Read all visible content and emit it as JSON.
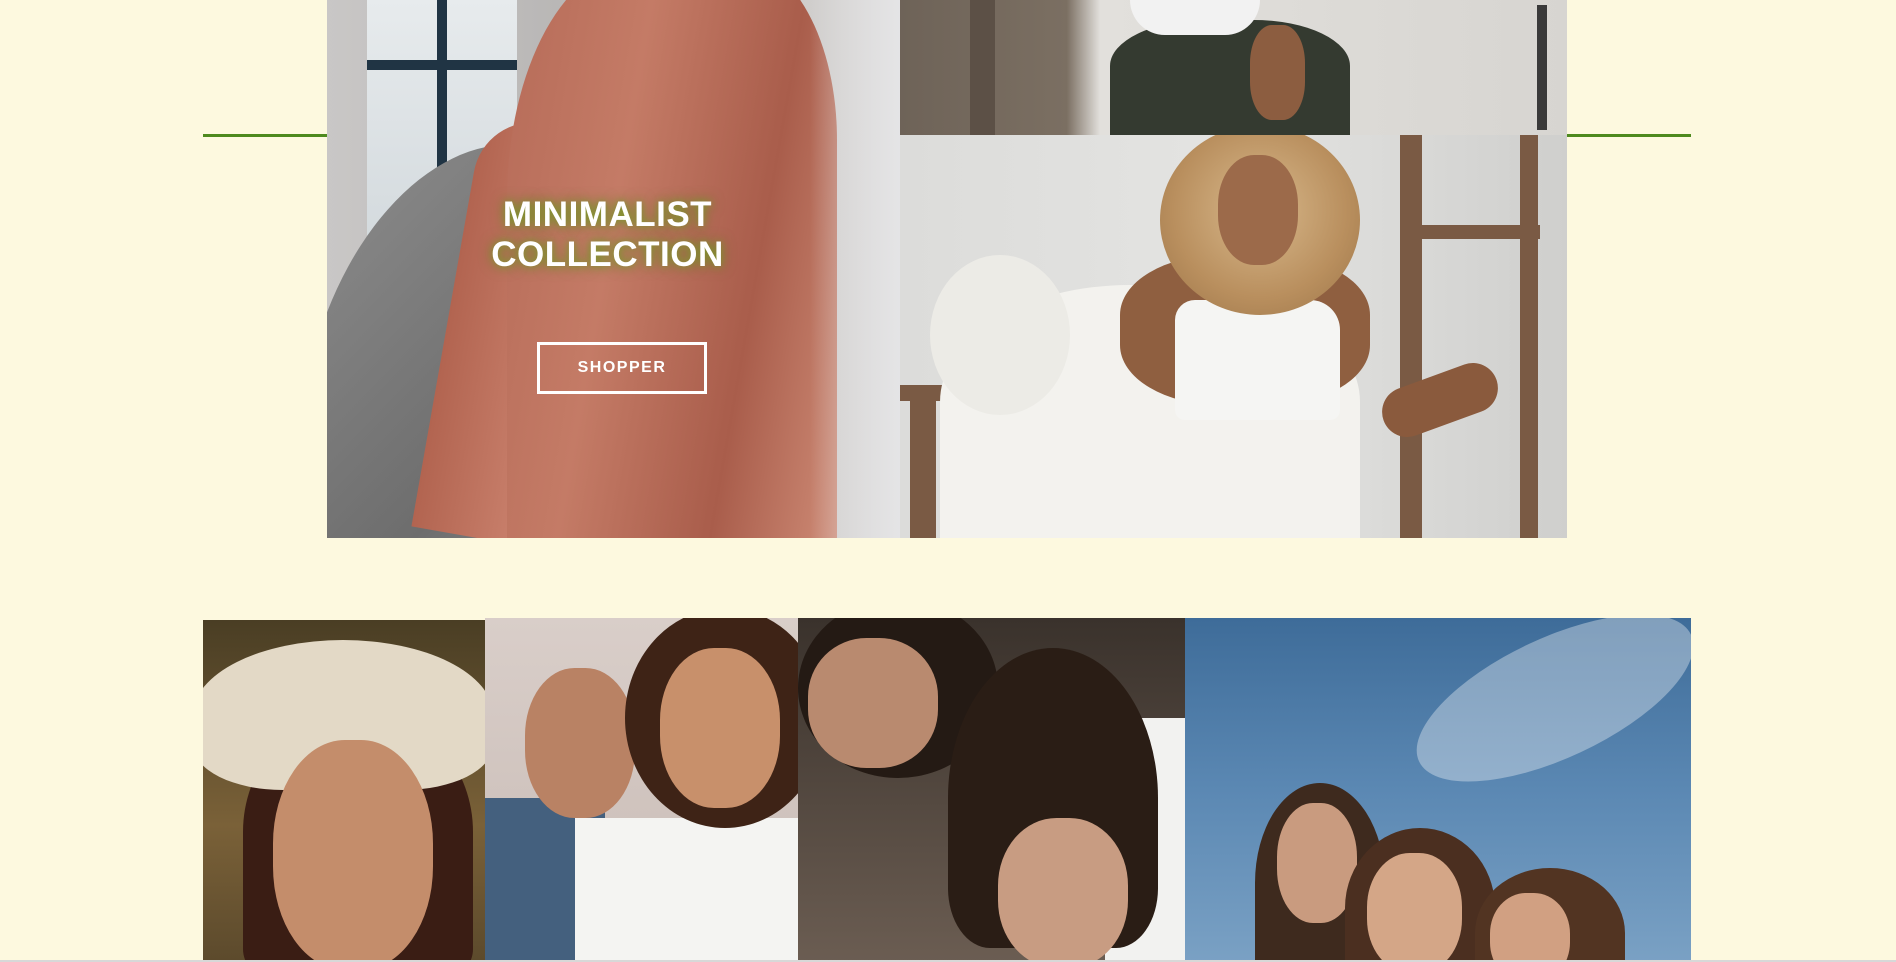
{
  "hero": {
    "headline_line1": "MINIMALIST",
    "headline_line2": "COLLECTION",
    "button_label": "SHOPPER"
  },
  "colors": {
    "page_background": "#fdf9df",
    "accent_line": "#4e8a1e",
    "headline_text": "#ffffff",
    "button_border": "#ffffff"
  },
  "images": {
    "hero_left": "model-in-rust-hijab-photo",
    "hero_top_right": "seated-model-dark-pants-photo",
    "hero_bottom_right": "model-in-white-on-wooden-chair-photo",
    "gallery": [
      "woman-in-white-hat-photo",
      "two-women-white-shirts-photo",
      "two-women-heads-together-photo",
      "three-women-blue-sky-photo"
    ]
  }
}
